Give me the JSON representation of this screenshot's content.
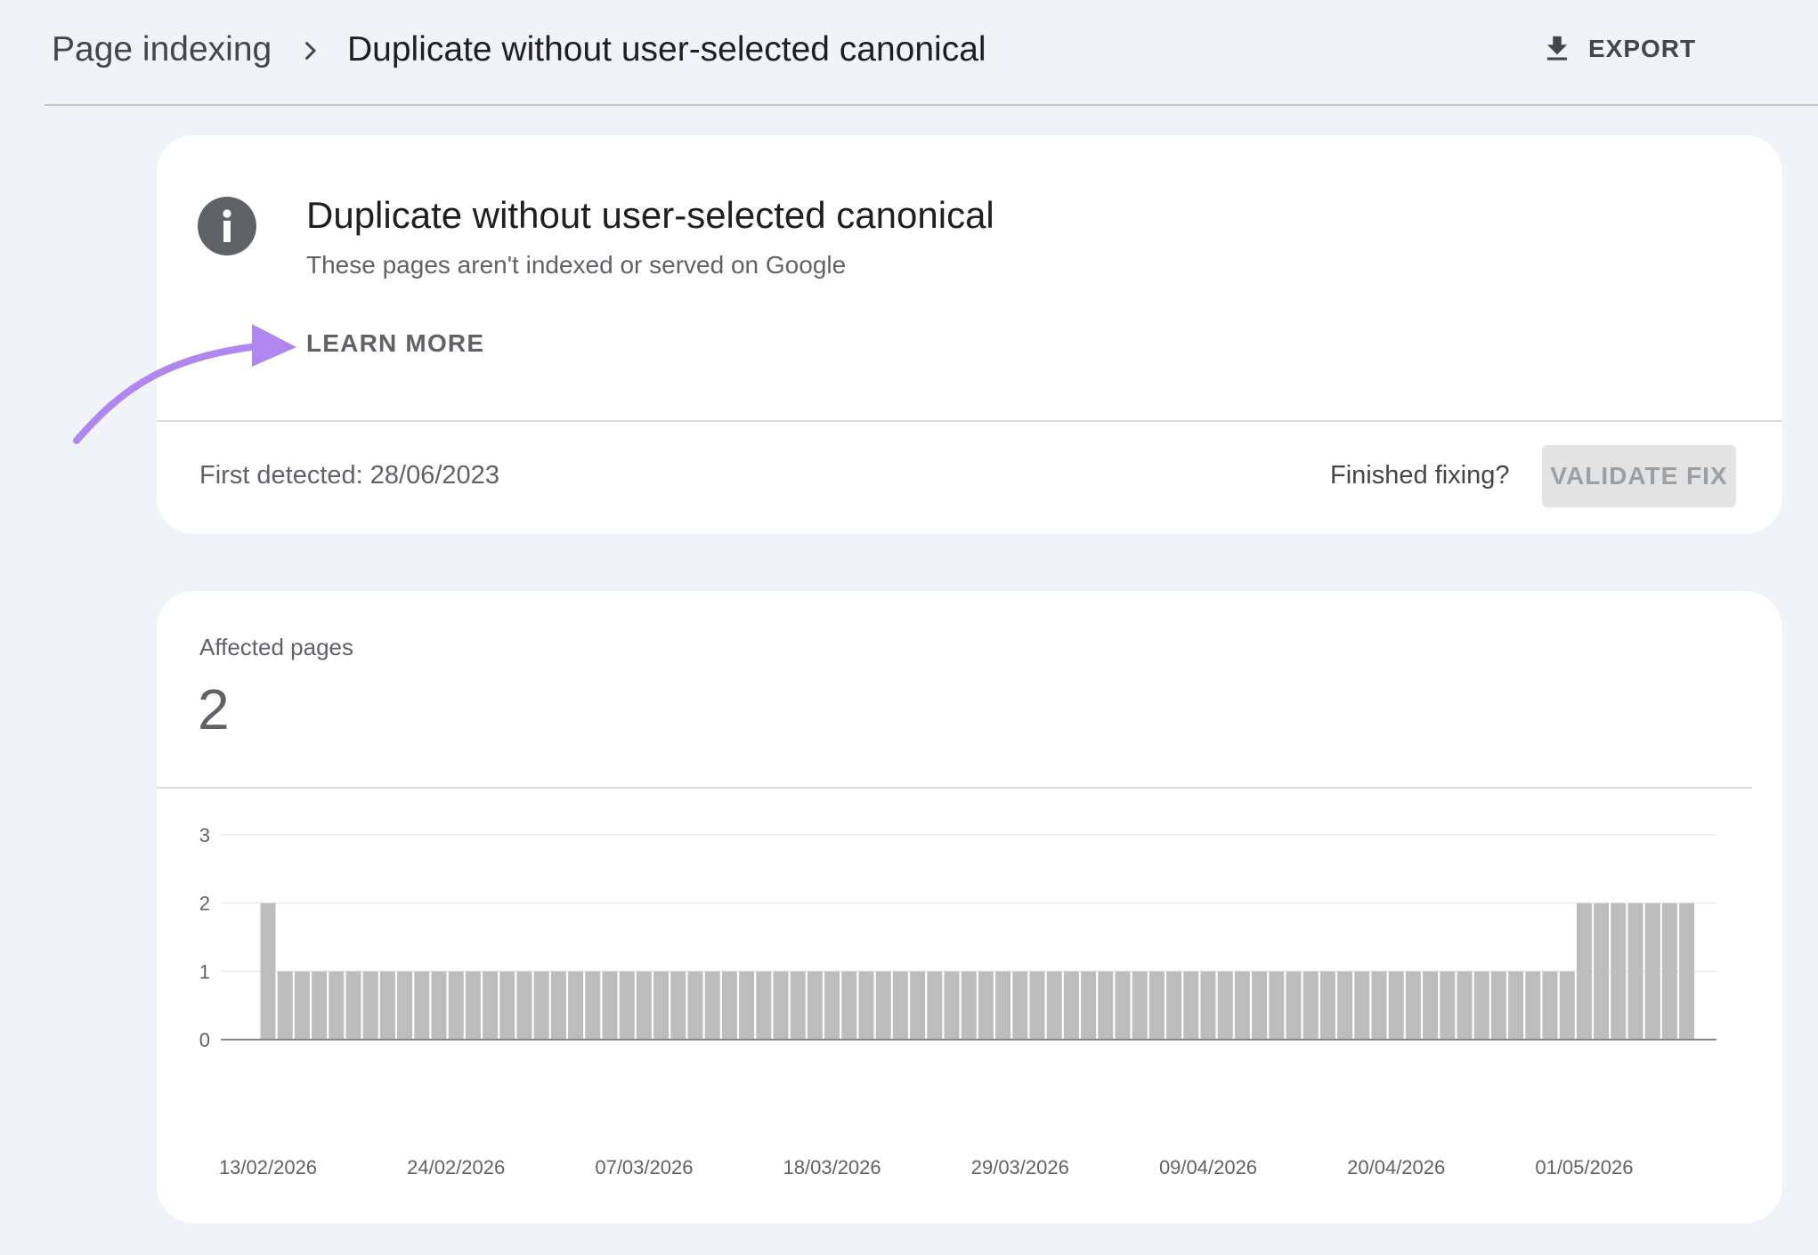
{
  "breadcrumb": {
    "root": "Page indexing",
    "current": "Duplicate without user-selected canonical"
  },
  "toolbar": {
    "export_label": "EXPORT",
    "export_icon": "download-icon"
  },
  "issue": {
    "icon": "info-icon",
    "title": "Duplicate without user-selected canonical",
    "subtitle": "These pages aren't indexed or served on Google",
    "learn_more": "LEARN MORE",
    "first_detected": "First detected: 28/06/2023",
    "finished_prompt": "Finished fixing?",
    "validate_label": "VALIDATE FIX"
  },
  "annotation": {
    "color": "#b086f0"
  },
  "affected": {
    "label": "Affected pages",
    "value": "2"
  },
  "chart_data": {
    "type": "bar",
    "x_tick_labels": [
      "13/02/2026",
      "24/02/2026",
      "07/03/2026",
      "18/03/2026",
      "29/03/2026",
      "09/04/2026",
      "20/04/2026",
      "01/05/2026"
    ],
    "y_ticks": [
      0,
      1,
      2,
      3
    ],
    "ylim": [
      0,
      3
    ],
    "grid": true,
    "bar_color": "#bdbdbd",
    "values": [
      2,
      1,
      1,
      1,
      1,
      1,
      1,
      1,
      1,
      1,
      1,
      1,
      1,
      1,
      1,
      1,
      1,
      1,
      1,
      1,
      1,
      1,
      1,
      1,
      1,
      1,
      1,
      1,
      1,
      1,
      1,
      1,
      1,
      1,
      1,
      1,
      1,
      1,
      1,
      1,
      1,
      1,
      1,
      1,
      1,
      1,
      1,
      1,
      1,
      1,
      1,
      1,
      1,
      1,
      1,
      1,
      1,
      1,
      1,
      1,
      1,
      1,
      1,
      1,
      1,
      1,
      1,
      1,
      1,
      1,
      1,
      1,
      1,
      1,
      1,
      1,
      1,
      2,
      2,
      2,
      2,
      2,
      2,
      2
    ]
  }
}
